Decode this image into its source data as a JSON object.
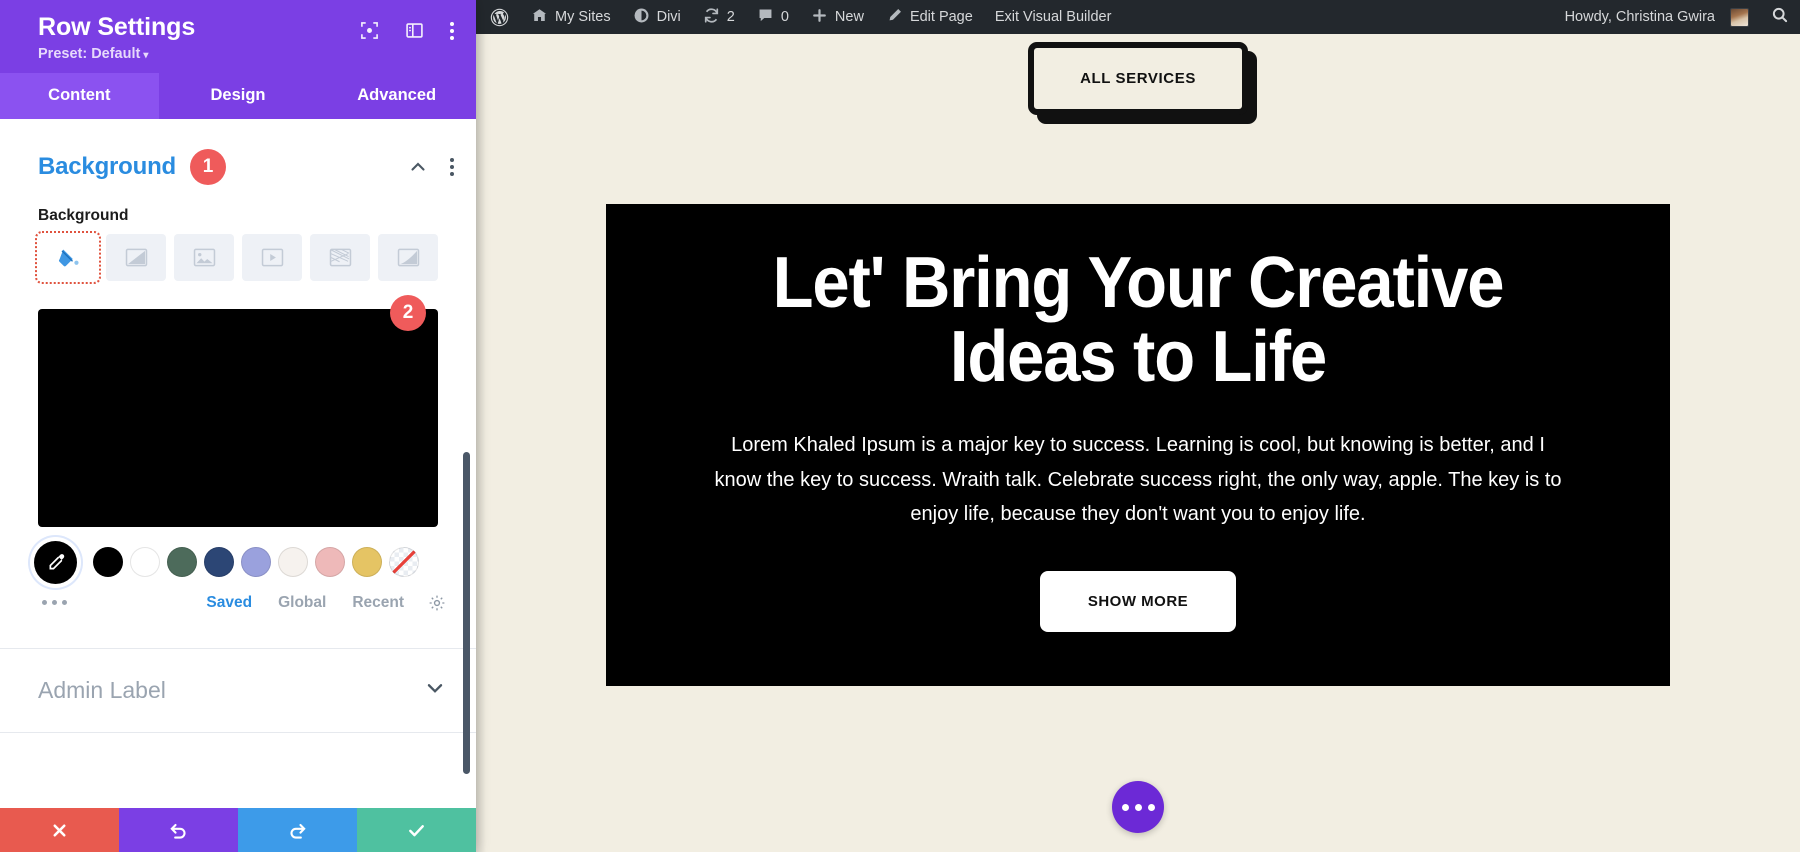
{
  "settings_panel": {
    "title": "Row Settings",
    "preset_label": "Preset: Default",
    "preset_caret": "▾",
    "header_icons": [
      {
        "name": "focus-target-icon"
      },
      {
        "name": "layout-panel-icon"
      },
      {
        "name": "kebab-menu-icon"
      }
    ],
    "tabs": [
      {
        "label": "Content",
        "active": true
      },
      {
        "label": "Design",
        "active": false
      },
      {
        "label": "Advanced",
        "active": false
      }
    ],
    "section": {
      "title": "Background",
      "badge": "1",
      "collapse_icon": "chevron-up-icon",
      "options_icon": "kebab-menu-icon"
    },
    "field": {
      "label": "Background",
      "background_types": [
        {
          "name": "paint-bucket-icon",
          "label": "Color",
          "active": true
        },
        {
          "name": "gradient-icon",
          "label": "Gradient",
          "active": false
        },
        {
          "name": "image-icon",
          "label": "Image",
          "active": false
        },
        {
          "name": "video-icon",
          "label": "Video",
          "active": false
        },
        {
          "name": "pattern-icon",
          "label": "Pattern",
          "active": false
        },
        {
          "name": "mask-icon",
          "label": "Mask",
          "active": false
        }
      ]
    },
    "color_preview": {
      "value": "#000000",
      "badge": "2"
    },
    "swatches": [
      {
        "name": "eyedropper",
        "color": "#000000",
        "selected": true
      },
      {
        "name": "black",
        "color": "#000000"
      },
      {
        "name": "white",
        "color": "#ffffff"
      },
      {
        "name": "dark-green",
        "color": "#4d6b5b"
      },
      {
        "name": "navy-blue",
        "color": "#2c4675"
      },
      {
        "name": "periwinkle",
        "color": "#9aa1dd"
      },
      {
        "name": "cream",
        "color": "#f6f2ee"
      },
      {
        "name": "pink",
        "color": "#eeb9b9"
      },
      {
        "name": "gold",
        "color": "#e5c464"
      },
      {
        "name": "transparent",
        "color": "transparent"
      }
    ],
    "swatch_tabs": [
      {
        "label": "Saved",
        "active": true
      },
      {
        "label": "Global",
        "active": false
      },
      {
        "label": "Recent",
        "active": false
      }
    ],
    "swatch_settings_icon": "gear-icon",
    "swatch_more_icon": "ellipsis-icon",
    "admin_label": {
      "label": "Admin Label",
      "chevron": "chevron-down-icon"
    },
    "footer_buttons": [
      {
        "name": "cancel-button",
        "icon": "✖",
        "color": "#e85a4f"
      },
      {
        "name": "undo-button",
        "icon": "↺",
        "color": "#7b3fe4"
      },
      {
        "name": "redo-button",
        "icon": "↻",
        "color": "#3d9be9"
      },
      {
        "name": "save-button",
        "icon": "✔",
        "color": "#4fc1a0"
      }
    ]
  },
  "adminbar": {
    "items": [
      {
        "name": "wordpress-logo",
        "label": "",
        "icon": "wordpress-icon"
      },
      {
        "name": "my-sites",
        "label": "My Sites",
        "icon": "sites-icon"
      },
      {
        "name": "divi",
        "label": "Divi",
        "icon": "divi-icon"
      },
      {
        "name": "updates",
        "label": "2",
        "icon": "update-icon"
      },
      {
        "name": "comments",
        "label": "0",
        "icon": "comment-icon"
      },
      {
        "name": "new",
        "label": "New",
        "icon": "plus-icon"
      },
      {
        "name": "edit-page",
        "label": "Edit Page",
        "icon": "pencil-icon"
      },
      {
        "name": "exit-visual-builder",
        "label": "Exit Visual Builder",
        "icon": ""
      }
    ],
    "howdy": "Howdy, Christina Gwira",
    "search_icon": "search-icon"
  },
  "canvas": {
    "all_services_button": "ALL SERVICES",
    "hero": {
      "heading": "Let' Bring Your Creative Ideas to Life",
      "paragraph": "Lorem Khaled Ipsum is a major key to success. Learning is cool, but knowing is better, and I know the key to success. Wraith talk. Celebrate success right, the only way, apple. The key is to enjoy life, because they don't want you to enjoy life.",
      "cta": "SHOW MORE",
      "background_color": "#000000"
    },
    "fab": {
      "name": "page-settings-fab",
      "icon": "ellipsis-icon",
      "color": "#6c29d6"
    },
    "page_background": "#f2eee2"
  }
}
